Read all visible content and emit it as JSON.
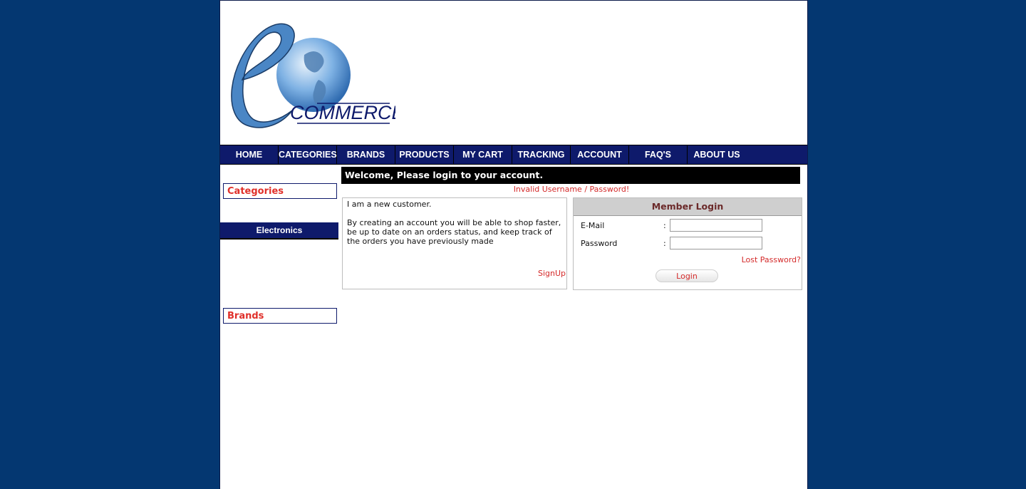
{
  "logo": {
    "letter": "e",
    "word": "COMMERCE"
  },
  "nav": [
    "HOME",
    "CATEGORIES",
    "BRANDS",
    "PRODUCTS",
    "MY CART",
    "TRACKING",
    "ACCOUNT",
    "FAQ'S",
    "ABOUT US"
  ],
  "sidebar": {
    "categories_title": "Categories",
    "category_items": [
      "Electronics"
    ],
    "brands_title": "Brands"
  },
  "main": {
    "welcome": "Welcome, Please login to your account.",
    "error": "Invalid Username / Password!",
    "new_customer": {
      "heading": "I am a new customer.",
      "body": "By creating an account you will be able to shop faster, be up to date on an orders status, and keep track of the orders you have previously made",
      "signup": "SignUp"
    },
    "member_login": {
      "title": "Member Login",
      "email_label": "E-Mail",
      "password_label": "Password",
      "colon": ":",
      "email_value": "",
      "password_value": "",
      "lost_password": "Lost Password?",
      "login_button": "Login"
    }
  },
  "colors": {
    "background": "#043771",
    "nav": "#0e1a6b",
    "accent_red": "#d42a2a"
  }
}
